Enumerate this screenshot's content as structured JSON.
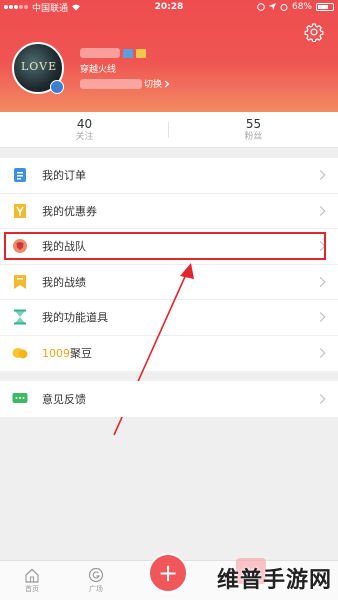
{
  "status_bar": {
    "carrier": "中国联通",
    "time": "20:28",
    "battery": "68%"
  },
  "profile": {
    "signature": "穿越火线",
    "switch_label": "切换",
    "avatar_text": "LOVE"
  },
  "stats": [
    {
      "value": "40",
      "label": "关注"
    },
    {
      "value": "55",
      "label": "粉丝"
    }
  ],
  "menu": [
    {
      "label": "我的订单",
      "icon": "order-icon"
    },
    {
      "label": "我的优惠券",
      "icon": "coupon-icon"
    },
    {
      "label": "我的战队",
      "icon": "team-icon"
    },
    {
      "label": "我的战绩",
      "icon": "record-icon"
    },
    {
      "label": "我的功能道具",
      "icon": "hourglass-icon"
    },
    {
      "label_value": "1009",
      "label_text": "聚豆",
      "icon": "bean-icon"
    }
  ],
  "feedback": {
    "label": "意见反馈",
    "icon": "chat-icon"
  },
  "tabs": [
    {
      "label": "首页",
      "icon": "home-icon"
    },
    {
      "label": "广场",
      "icon": "square-icon"
    }
  ],
  "plus_label": "+",
  "watermark": "维普手游网",
  "colors": {
    "header_top": "#ee4d4f",
    "header_bottom": "#f28a63",
    "highlight": "#e3262c",
    "bean_count": "#f0a21c"
  }
}
